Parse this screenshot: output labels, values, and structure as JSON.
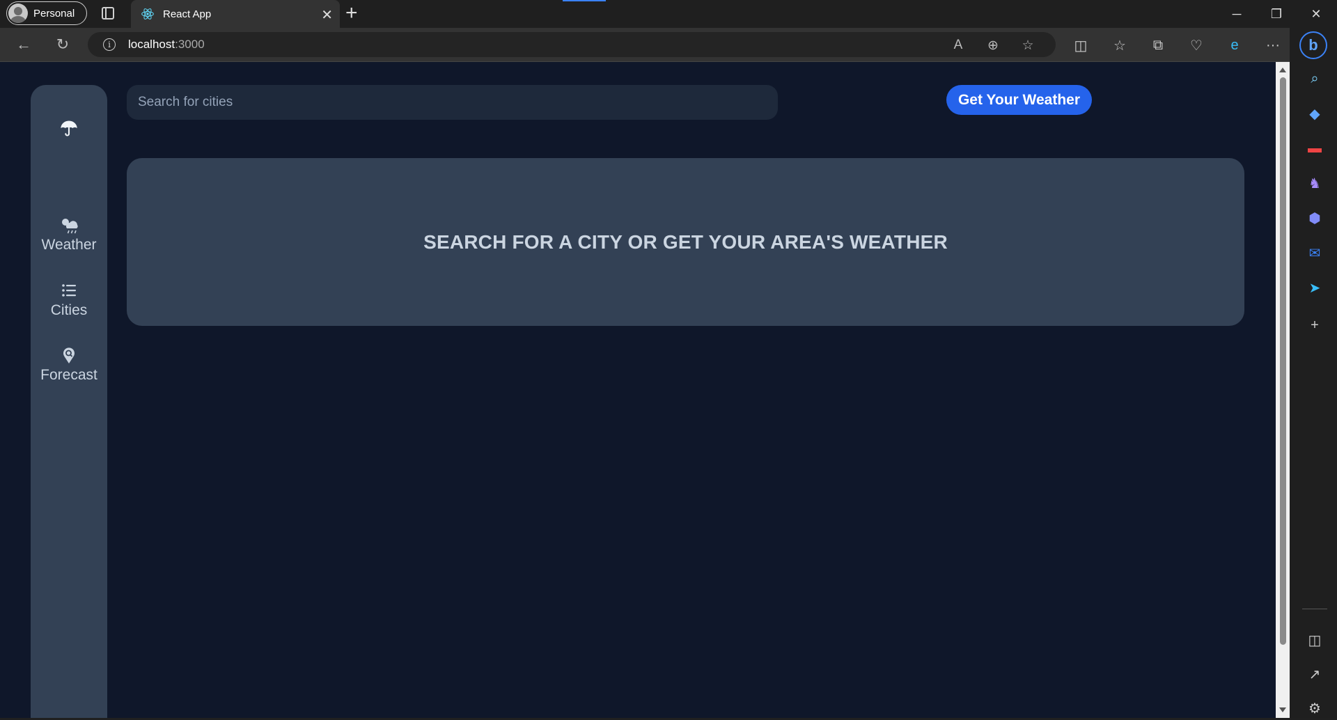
{
  "browser": {
    "profile_label": "Personal",
    "tab_title": "React App",
    "url_host": "localhost",
    "url_port": ":3000"
  },
  "app": {
    "nav_items": [
      {
        "label": "Weather",
        "icon": "cloud-sun-rain-icon"
      },
      {
        "label": "Cities",
        "icon": "list-icon"
      },
      {
        "label": "Forecast",
        "icon": "map-search-icon"
      }
    ],
    "search_placeholder": "Search for cities",
    "weather_button_label": "Get Your Weather",
    "message": "SEARCH FOR A CITY OR GET YOUR AREA'S WEATHER"
  },
  "colors": {
    "page_bg": "#0f172a",
    "panel": "#334155",
    "input_bg": "#1e293b",
    "accent": "#2563eb"
  }
}
